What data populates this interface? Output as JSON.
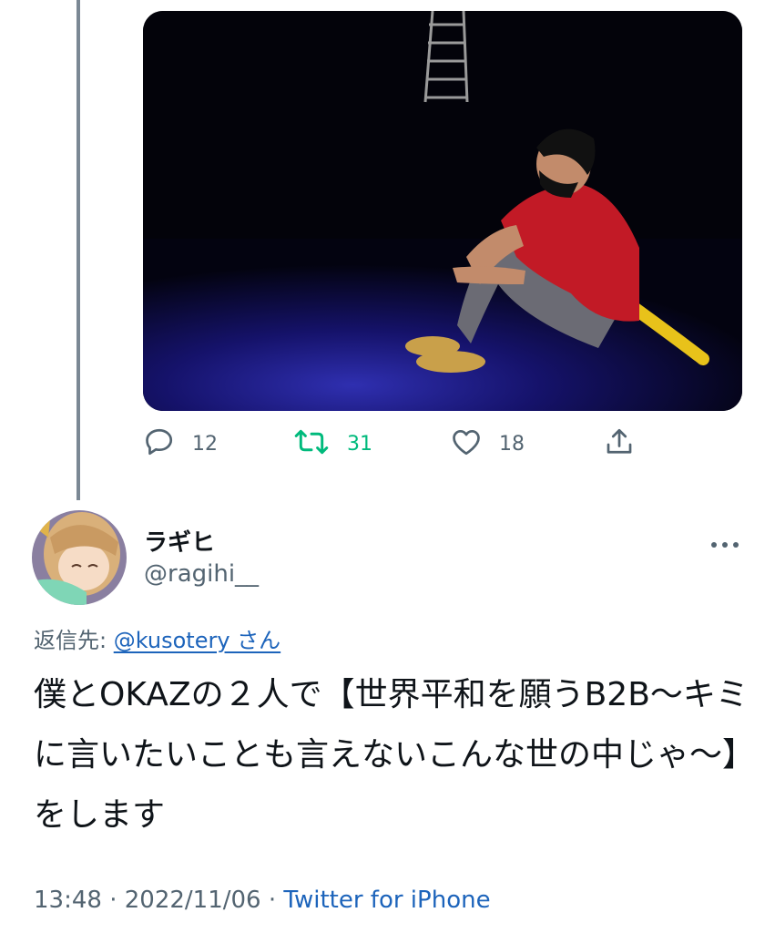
{
  "previous_tweet": {
    "photo_alt": "Man in red shirt and mask sitting on a dark stage under blue light",
    "actions": {
      "reply_count": "12",
      "retweet_count": "31",
      "like_count": "18"
    },
    "colors": {
      "retweet_active": "#00ba7c",
      "icon_gray": "#536471"
    }
  },
  "tweet": {
    "display_name": "ラギヒ",
    "handle": "@ragihi__",
    "reply_prefix": "返信先: ",
    "reply_mention": "@kusotery さん",
    "text": "僕とOKAZの２人で【世界平和を願うB2B〜キミに言いたいことも言えないこんな世の中じゃ〜】をします",
    "time": "13:48",
    "separator": " · ",
    "date": "2022/11/06",
    "source": "Twitter for iPhone"
  },
  "colors": {
    "link": "#1d64bb",
    "text": "#0f1419",
    "secondary": "#536471"
  }
}
